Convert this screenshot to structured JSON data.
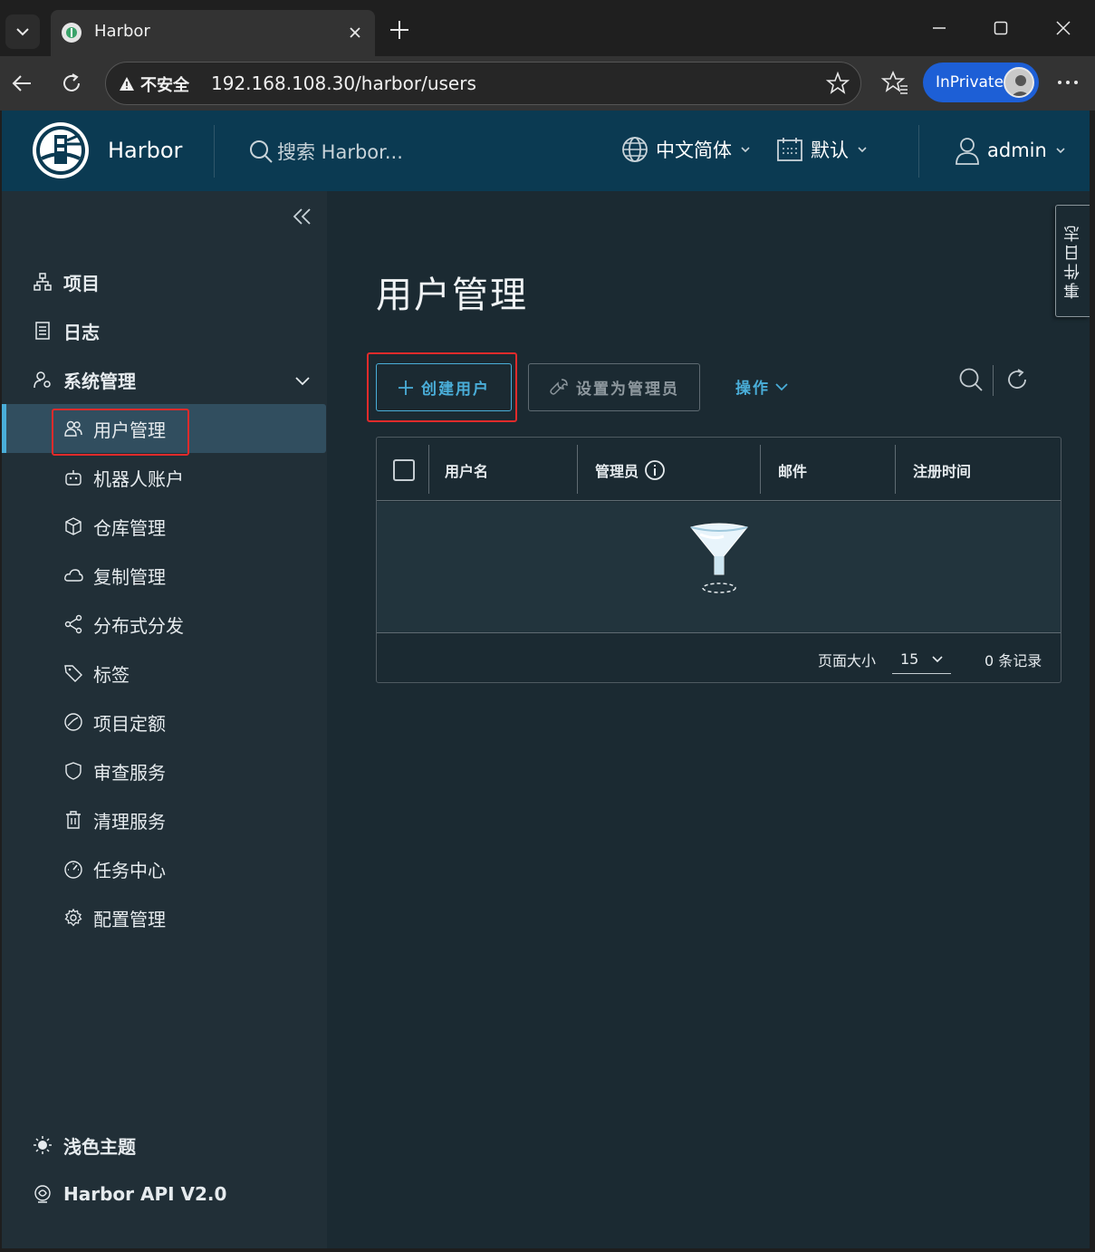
{
  "browser": {
    "tab_title": "Harbor",
    "security_label": "不安全",
    "url": "192.168.108.30/harbor/users",
    "inprivate_label": "InPrivate"
  },
  "header": {
    "brand": "Harbor",
    "search_placeholder": "搜索 Harbor...",
    "language": "中文简体",
    "date_format": "默认",
    "user": "admin"
  },
  "sidebar": {
    "top_items": [
      {
        "label": "项目",
        "icon": "projects-icon"
      },
      {
        "label": "日志",
        "icon": "logs-icon"
      },
      {
        "label": "系统管理",
        "icon": "admin-icon"
      }
    ],
    "sub_items": [
      {
        "label": "用户管理",
        "icon": "users-icon"
      },
      {
        "label": "机器人账户",
        "icon": "robot-icon"
      },
      {
        "label": "仓库管理",
        "icon": "registry-icon"
      },
      {
        "label": "复制管理",
        "icon": "replication-icon"
      },
      {
        "label": "分布式分发",
        "icon": "distribution-icon"
      },
      {
        "label": "标签",
        "icon": "tag-icon"
      },
      {
        "label": "项目定额",
        "icon": "quota-icon"
      },
      {
        "label": "审查服务",
        "icon": "shield-icon"
      },
      {
        "label": "清理服务",
        "icon": "trash-icon"
      },
      {
        "label": "任务中心",
        "icon": "dashboard-icon"
      },
      {
        "label": "配置管理",
        "icon": "gear-icon"
      }
    ],
    "footer": {
      "theme": "浅色主题",
      "api": "Harbor API V2.0"
    }
  },
  "main": {
    "title": "用户管理",
    "create_user": "创建用户",
    "set_admin": "设置为管理员",
    "actions": "操作",
    "columns": [
      "用户名",
      "管理员",
      "邮件",
      "注册时间"
    ],
    "page_size_label": "页面大小",
    "page_size": "15",
    "record_count": "0 条记录"
  },
  "event_log_tab": "事件日志",
  "colors": {
    "accent": "#4aaed9",
    "header_bg": "#0b3a52",
    "highlight_box": "#e02b2b"
  }
}
